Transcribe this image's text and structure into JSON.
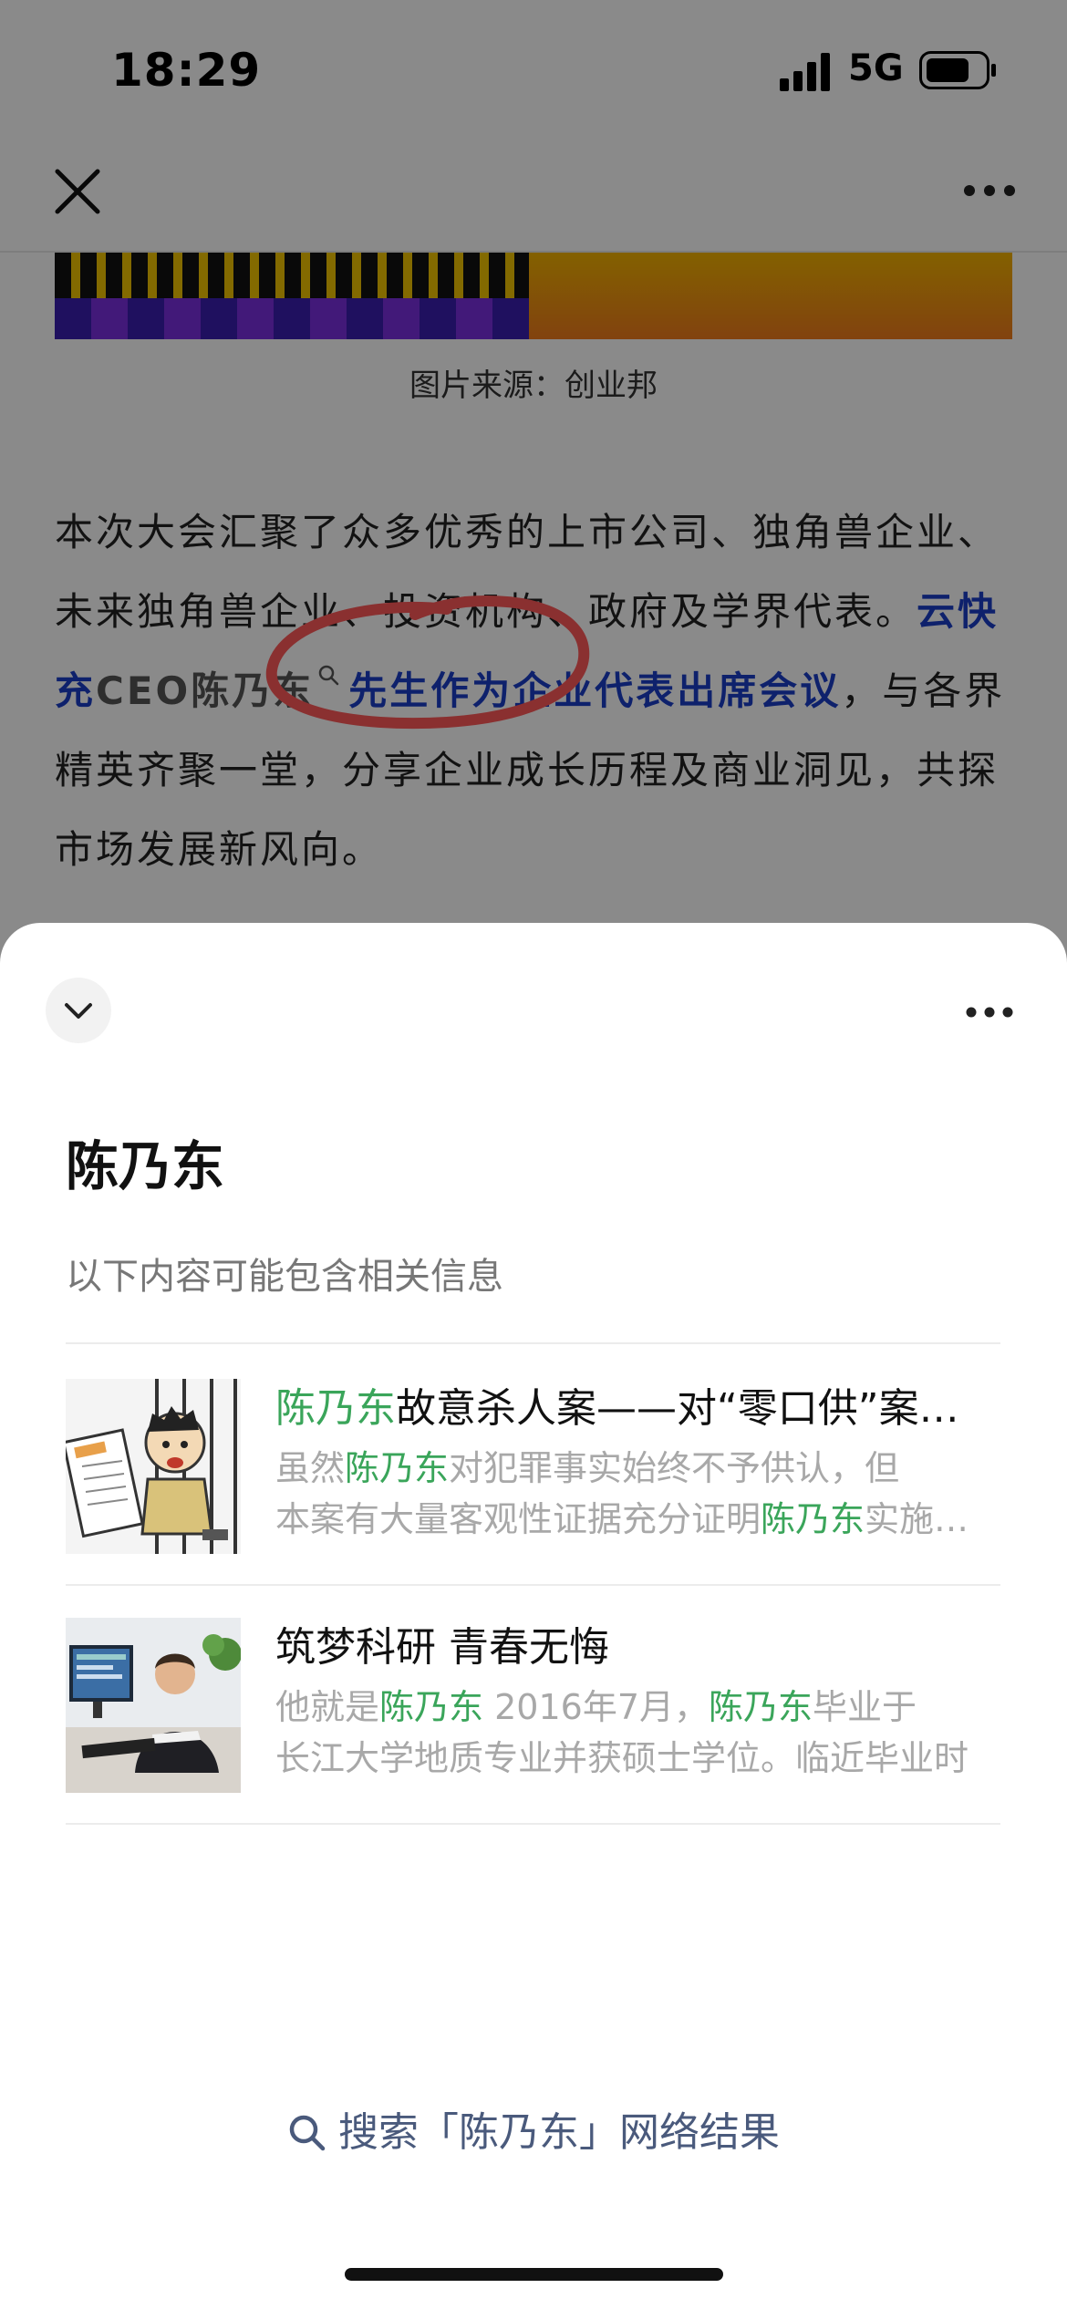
{
  "status_bar": {
    "time": "18:29",
    "network": "5G",
    "signal_icon": "signal-bars-icon",
    "battery_icon": "battery-icon"
  },
  "article": {
    "nav_icons": [
      "close-icon",
      "more-icon"
    ],
    "image_caption": "图片来源：创业邦",
    "paragraph_intro": "本次大会汇聚了众多优秀的上市公司、独角兽企业、未来独角兽企业、投资机构、政府及学界代表。",
    "link_part1": "云快充",
    "link_highlight": "CEO陈乃东",
    "link_part2": "先生作为企业代表出席会议",
    "paragraph_outro": "，与各界精英齐聚一堂，分享企业成长历程及商业洞见，共探市场发展新风向。",
    "link_color": "#1a3ec8"
  },
  "sheet": {
    "title": "陈乃东",
    "subtitle": "以下内容可能包含相关信息",
    "highlight_color": "#3aa55a",
    "results": [
      {
        "title_hl": "陈乃东",
        "title_rest": "故意杀人案——对“零口供”案件的审查与认定",
        "line1_a": "虽然",
        "line1_hl": "陈乃东",
        "line1_b": "对犯罪事实始终不予供认，但",
        "line2_a": "本案有大量客观性证据充分证明",
        "line2_hl": "陈乃东",
        "line2_b": "实施了犯罪行为",
        "thumb": "cartoon-prisoner-image"
      },
      {
        "title_rest": "筑梦科研 青春无悔",
        "line1_a": "他就是",
        "line1_hl": "陈乃东",
        "line1_b": " 2016年7月，",
        "line1_hl2": "陈乃东",
        "line1_c": "毕业于",
        "line2_a": "长江大学地质专业并获硕士学位。临近毕业时",
        "thumb": "man-at-computer-photo"
      }
    ],
    "web_search": "搜索「陈乃东」网络结果"
  }
}
